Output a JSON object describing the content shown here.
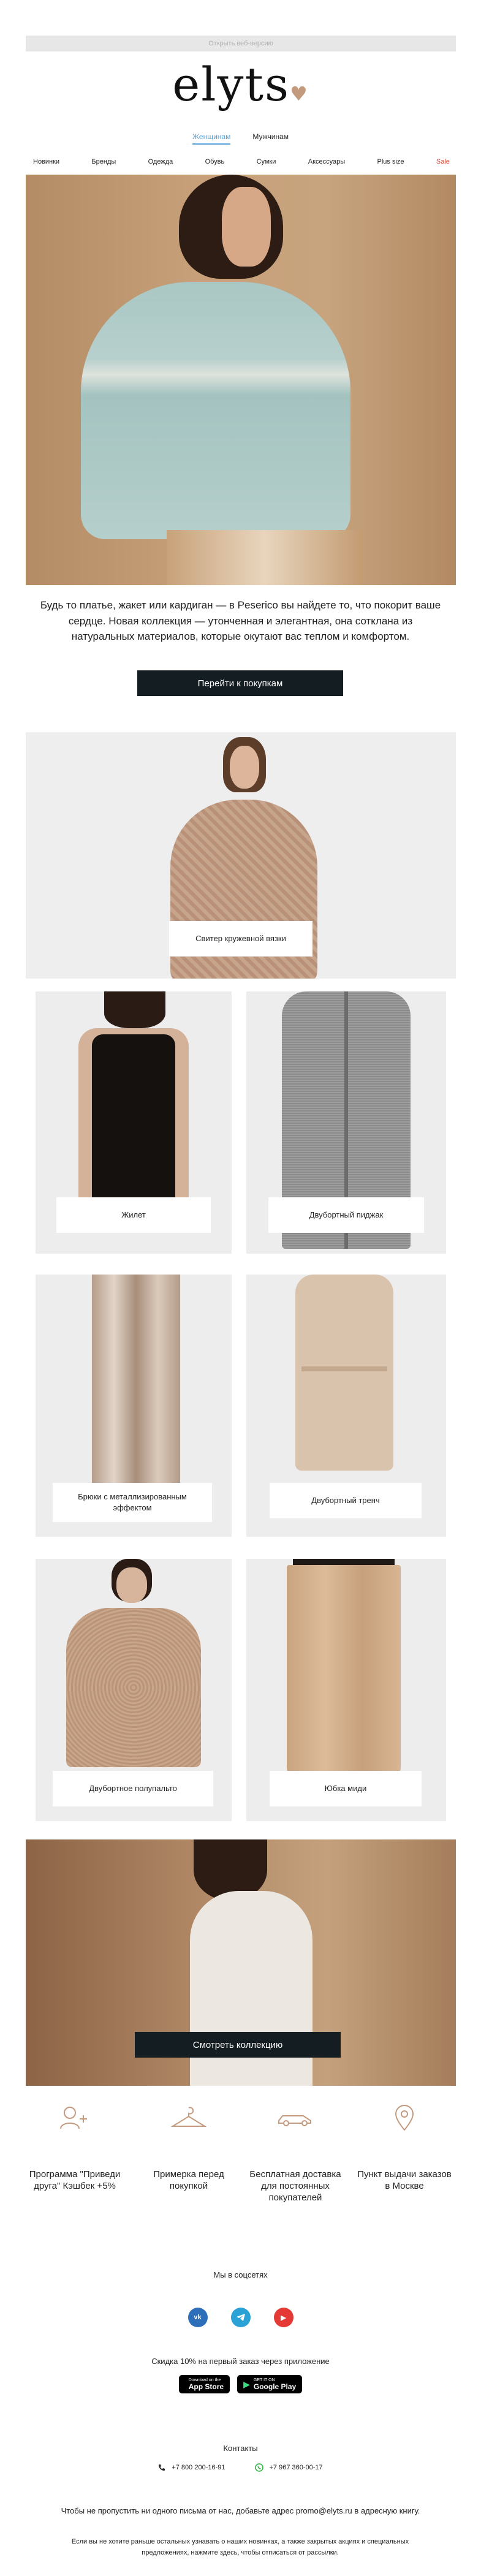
{
  "header": {
    "preheader": "Открыть веб-версию",
    "logo": "elyts",
    "gender_tabs": [
      {
        "label": "Женщинам",
        "active": true
      },
      {
        "label": "Мужчинам",
        "active": false
      }
    ],
    "menu": [
      "Новинки",
      "Бренды",
      "Одежда",
      "Обувь",
      "Сумки",
      "Аксессуары",
      "Plus size",
      "Sale"
    ]
  },
  "hero": {
    "text": "Будь то платье, жакет или кардиган — в Peserico вы найдете то, что покорит ваше сердце. Новая коллекция — утонченная и элегантная, она сотклана из натуральных материалов, которые окутают вас теплом и комфортом.",
    "cta": "Перейти к покупкам"
  },
  "products": {
    "featured": "Свитер кружевной вязки",
    "grid": [
      "Жилет",
      "Двубортный пиджак",
      "Брюки с металлизированным эффектом",
      "Двубортный тренч",
      "Двубортное полупальто",
      "Юбка миди"
    ]
  },
  "video": {
    "cta": "Смотреть коллекцию"
  },
  "features": [
    {
      "icon": "user-plus-icon",
      "text": "Программа \"Приведи друга\" Кэшбек +5%"
    },
    {
      "icon": "hanger-icon",
      "text": "Примерка перед покупкой"
    },
    {
      "icon": "car-icon",
      "text": "Бесплатная доставка для постоянных покупателей"
    },
    {
      "icon": "map-pin-icon",
      "text": "Пункт выдачи заказов в Москве"
    }
  ],
  "social": {
    "title": "Мы в соцсетях",
    "items": [
      {
        "icon": "vk-icon",
        "label": "vk",
        "color": "#2d6fb8"
      },
      {
        "icon": "telegram-icon",
        "label": "tg",
        "color": "#2aa2d6"
      },
      {
        "icon": "youtube-icon",
        "label": "▶",
        "color": "#e53935"
      }
    ]
  },
  "app": {
    "title": "Скидка 10% на первый заказ через приложение",
    "appstore_small": "Download on the",
    "appstore_big": "App Store",
    "googleplay_small": "GET IT ON",
    "googleplay_big": "Google Play"
  },
  "contacts": {
    "title": "Контакты",
    "phone": "+7 800 200-16-91",
    "whatsapp": "+7 967 360-00-17"
  },
  "footer": {
    "line1": "Чтобы не пропустить ни одного письма от нас, добавьте адрес promo@elyts.ru в адресную книгу.",
    "line2": "Если вы не хотите раньше остальных узнавать о наших новинках, а также закрытых акциях и специальных предложениях, нажмите здесь, чтобы отписаться от рассылки."
  }
}
